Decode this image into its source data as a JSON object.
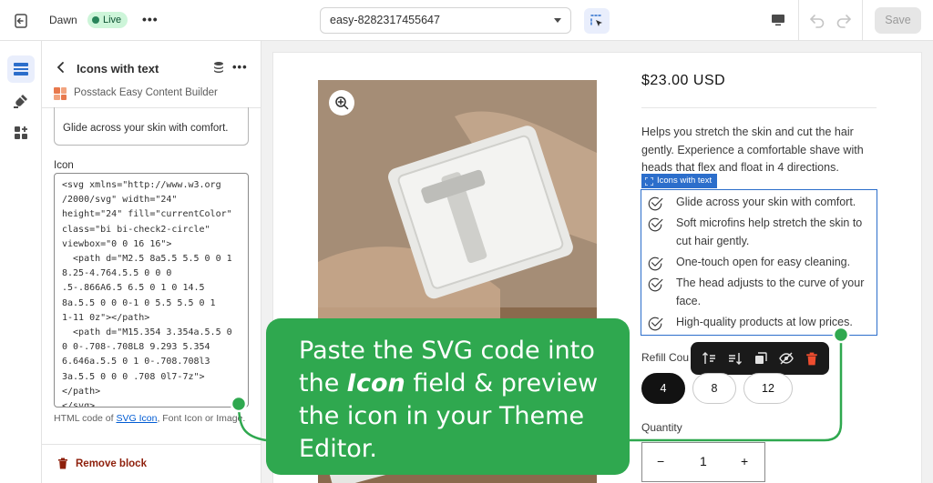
{
  "topbar": {
    "theme_name": "Dawn",
    "status": "Live",
    "more": "•••",
    "template_select": "easy-8282317455647",
    "save_label": "Save"
  },
  "panel": {
    "title": "Icons with text",
    "more": "•••",
    "app_name": "Posstack Easy Content Builder",
    "text_value": "Glide across your skin with comfort.",
    "icon_label": "Icon",
    "icon_code": "<svg xmlns=\"http://www.w3.org\n/2000/svg\" width=\"24\"\nheight=\"24\" fill=\"currentColor\"\nclass=\"bi bi-check2-circle\"\nviewbox=\"0 0 16 16\">\n  <path d=\"M2.5 8a5.5 5.5 0 0 1\n8.25-4.764.5.5 0 0 0\n.5-.866A6.5 6.5 0 1 0 14.5\n8a.5.5 0 0 0-1 0 5.5 5.5 0 1\n1-11 0z\"></path>\n  <path d=\"M15.354 3.354a.5.5 0\n0 0-.708-.708L8 9.293 5.354\n6.646a.5.5 0 1 0-.708.708l3\n3a.5.5 0 0 0 .708 0l7-7z\">\n</path>\n</svg>",
    "help_prefix": "HTML code of ",
    "help_link": "SVG Icon",
    "help_suffix": ", Font Icon or Image.",
    "remove_label": "Remove block"
  },
  "preview": {
    "price": "$23.00 USD",
    "description": "Helps you stretch the skin and cut the hair gently. Experience a comfortable shave with heads that flex and float in 4 directions.",
    "block_tag": "Icons with text",
    "items": [
      "Glide across your skin with comfort.",
      "Soft microfins help stretch the skin to cut hair gently.",
      "One-touch open for easy cleaning.",
      "The head adjusts to the curve of your face.",
      "High-quality products at low prices."
    ],
    "refill_label": "Refill Cou",
    "refill_options": [
      "4",
      "8",
      "12"
    ],
    "refill_selected": "4",
    "quantity_label": "Quantity",
    "quantity_value": "1",
    "qty_minus": "−",
    "qty_plus": "+"
  },
  "callout": {
    "line_a": "Paste the SVG code into the ",
    "emphasis": "Icon",
    "line_b": " field & preview the icon in your Theme Editor."
  },
  "colors": {
    "callout_green": "#2fa84f",
    "selection_blue": "#2c6ecb",
    "live_badge": "#cdf5d9",
    "remove_red": "#8e1f0b"
  }
}
